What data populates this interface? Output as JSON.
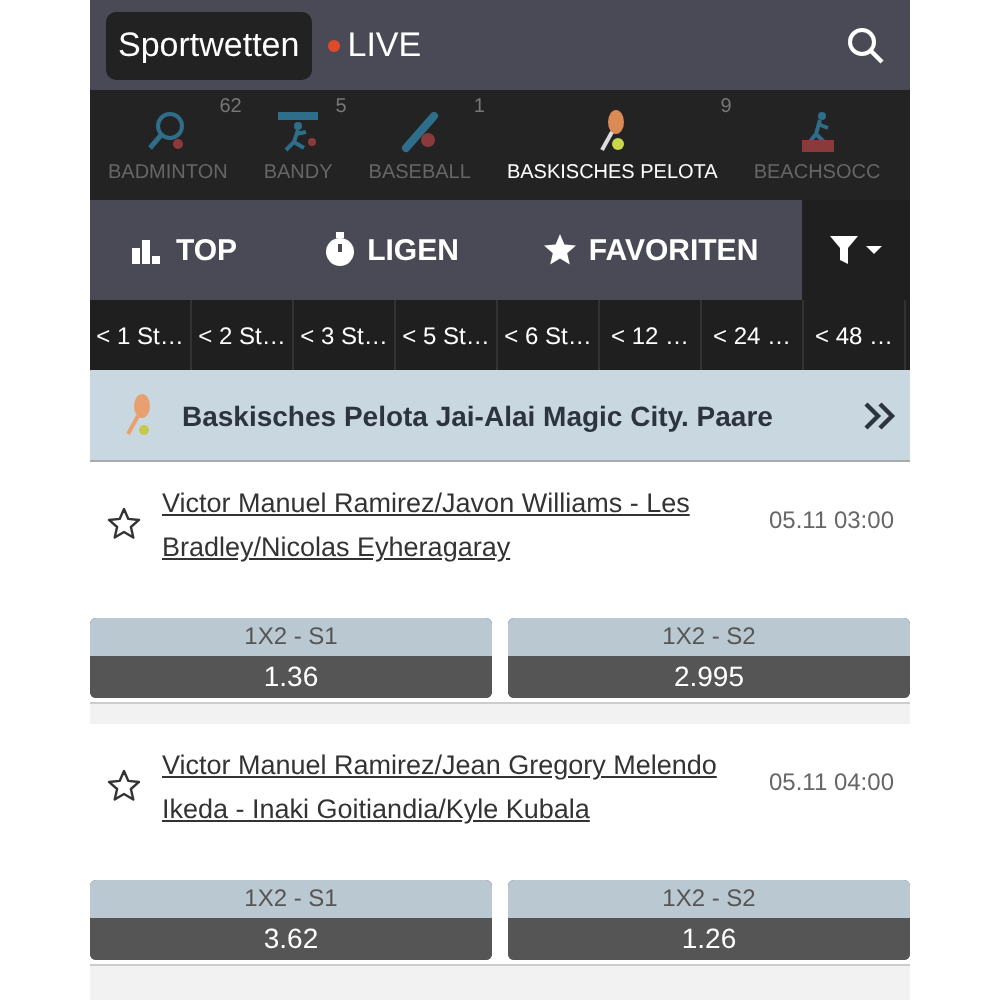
{
  "header": {
    "title": "Sportwetten",
    "live": "LIVE"
  },
  "sports": [
    {
      "name": "BADMINTON",
      "count": "62",
      "selected": false
    },
    {
      "name": "BANDY",
      "count": "5",
      "selected": false
    },
    {
      "name": "BASEBALL",
      "count": "1",
      "selected": false
    },
    {
      "name": "BASKISCHES PELOTA",
      "count": "9",
      "selected": true
    },
    {
      "name": "BEACHSOCC",
      "selected": false
    }
  ],
  "nav_tabs": [
    {
      "label": "TOP"
    },
    {
      "label": "LIGEN"
    },
    {
      "label": "FAVORITEN"
    }
  ],
  "time_filters": [
    "< 1 St…",
    "< 2 St…",
    "< 3 St…",
    "< 5 St…",
    "< 6 St…",
    "< 12 …",
    "< 24 …",
    "< 48 …"
  ],
  "league": {
    "title": "Baskisches Pelota Jai-Alai Magic City. Paare"
  },
  "matches": [
    {
      "name": "Victor Manuel Ramirez/Javon Williams - Les Bradley/Nicolas Eyheragaray",
      "time": "05.11 03:00",
      "favorite": false,
      "odds": [
        {
          "label": "1X2 - S1",
          "value": "1.36"
        },
        {
          "label": "1X2 - S2",
          "value": "2.995"
        }
      ]
    },
    {
      "name": "Victor Manuel Ramirez/Jean Gregory Melendo Ikeda - Inaki Goitiandia/Kyle Kubala",
      "time": "05.11 04:00",
      "favorite": false,
      "odds": [
        {
          "label": "1X2 - S1",
          "value": "3.62"
        },
        {
          "label": "1X2 - S2",
          "value": "1.26"
        }
      ]
    }
  ]
}
